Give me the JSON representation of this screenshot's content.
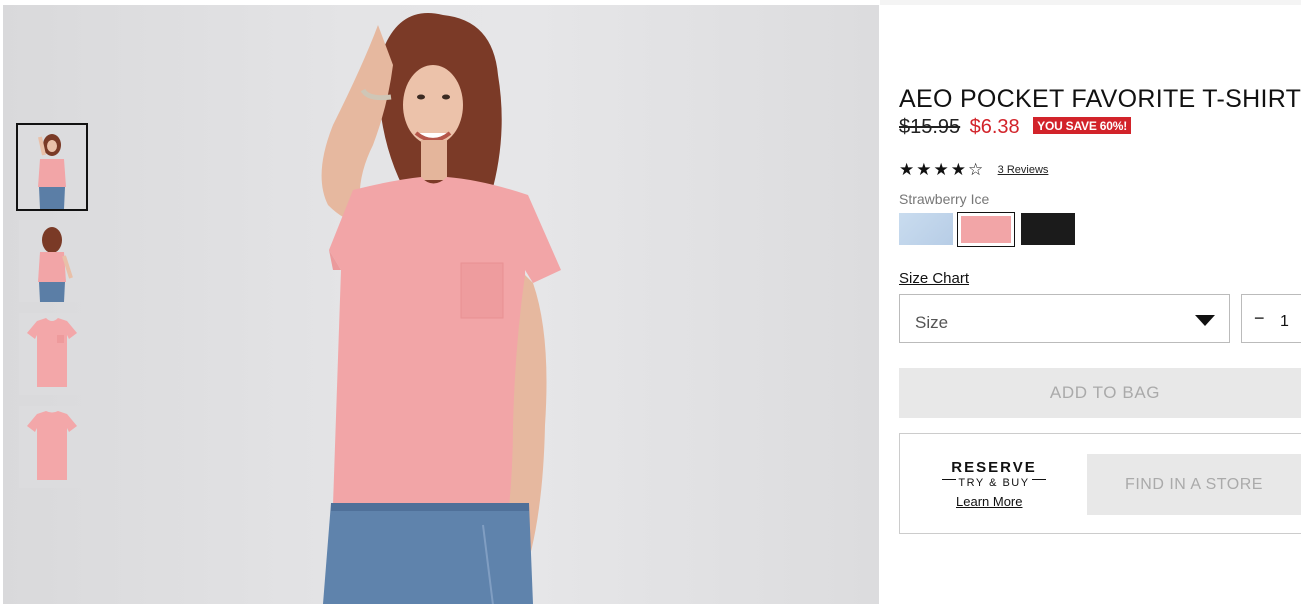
{
  "product": {
    "title": "AEO POCKET FAVORITE T-SHIRT",
    "old_price": "$15.95",
    "new_price": "$6.38",
    "save_badge": "YOU SAVE 60%!",
    "rating": {
      "stars_display": "★★★★☆",
      "stars": 4,
      "max": 5,
      "reviews_label": "3 Reviews"
    },
    "color_name": "Strawberry Ice",
    "swatches": [
      {
        "name": "light-blue",
        "color": "#c9dcef"
      },
      {
        "name": "strawberry-ice",
        "color": "#f2a5a7",
        "selected": true
      },
      {
        "name": "black",
        "color": "#1b1b1b"
      }
    ],
    "size_chart_label": "Size Chart",
    "size_select_label": "Size",
    "quantity_minus": "−",
    "quantity": "1",
    "add_to_bag_label": "ADD TO BAG",
    "reserve": {
      "logo_line1": "RESERVE",
      "logo_line2": "TRY & BUY",
      "learn_more": "Learn More",
      "find_in_store": "FIND IN A STORE"
    }
  },
  "gallery": {
    "thumbnails": [
      "model-front",
      "model-back",
      "shirt-front",
      "shirt-back"
    ],
    "active_index": 0
  },
  "colors": {
    "sale_red": "#d2232a",
    "shirt_pink": "#f2a5a7",
    "button_gray": "#e8e8e8"
  }
}
